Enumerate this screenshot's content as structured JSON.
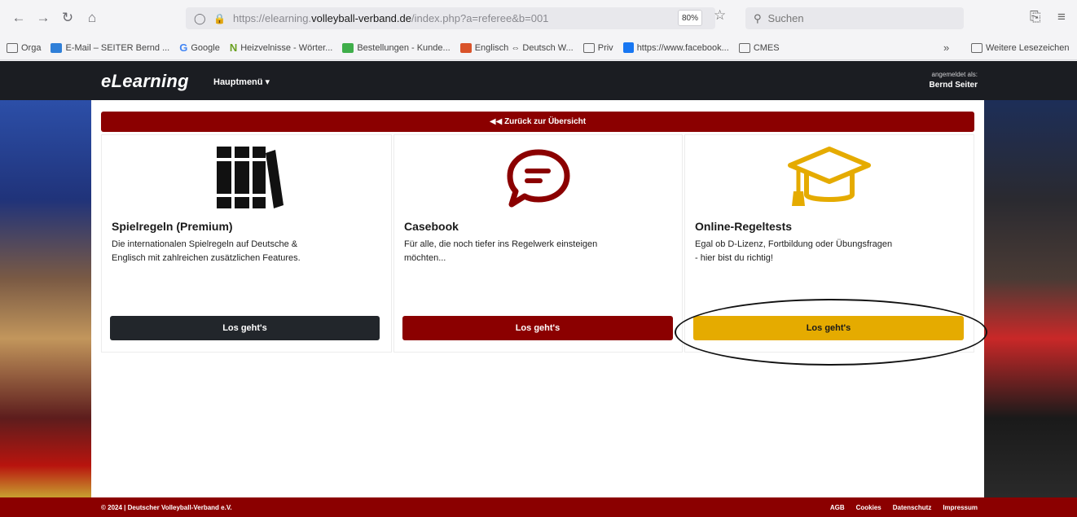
{
  "browser": {
    "url_pre": "https://elearning.",
    "url_host": "volleyball-verband.de",
    "url_post": "/index.php?a=referee&b=001",
    "zoom": "80%",
    "search_placeholder": "Suchen"
  },
  "bookmarks": [
    {
      "label": "Orga",
      "icon": "folder-icon"
    },
    {
      "label": "E-Mail – SEITER Bernd ...",
      "icon": "mail-icon"
    },
    {
      "label": "Google",
      "icon": "google-icon"
    },
    {
      "label": "Heizvelnisse - Wörter...",
      "icon": "n-icon"
    },
    {
      "label": "Bestellungen - Kunde...",
      "icon": "sheet-icon"
    },
    {
      "label": "Englisch ⇔ Deutsch W...",
      "icon": "dict-icon"
    },
    {
      "label": "Priv",
      "icon": "folder-icon"
    },
    {
      "label": "https://www.facebook...",
      "icon": "facebook-icon"
    },
    {
      "label": "CMES",
      "icon": "folder-icon"
    }
  ],
  "bookmarks_more": "Weitere Lesezeichen",
  "site": {
    "brand": "eLearning",
    "menu_label": "Hauptmenü ▾",
    "user_caption": "angemeldet als:",
    "user_name": "Bernd Seiter",
    "back_label": "◀◀ Zurück zur Übersicht"
  },
  "cards": [
    {
      "title": "Spielregeln (Premium)",
      "text_line1": "Die internationalen Spielregeln auf Deutsche &",
      "text_line2": "Englisch mit zahlreichen zusätzlichen Features.",
      "button": "Los geht's",
      "icon": "books-icon"
    },
    {
      "title": "Casebook",
      "text_line1": "Für alle, die noch tiefer ins Regelwerk einsteigen",
      "text_line2": "möchten...",
      "button": "Los geht's",
      "icon": "speech-bubble-icon"
    },
    {
      "title": "Online-Regeltests",
      "text_line1": "Egal ob D-Lizenz, Fortbildung oder Übungsfragen",
      "text_line2": "- hier bist du richtig!",
      "button": "Los geht's",
      "icon": "graduation-cap-icon"
    }
  ],
  "colors": {
    "dark": "#22262b",
    "red": "#8b0000",
    "gold": "#e5ab00"
  },
  "footer": {
    "copyright": "© 2024 | Deutscher Volleyball-Verband e.V.",
    "links": [
      "AGB",
      "Cookies",
      "Datenschutz",
      "Impressum"
    ]
  }
}
